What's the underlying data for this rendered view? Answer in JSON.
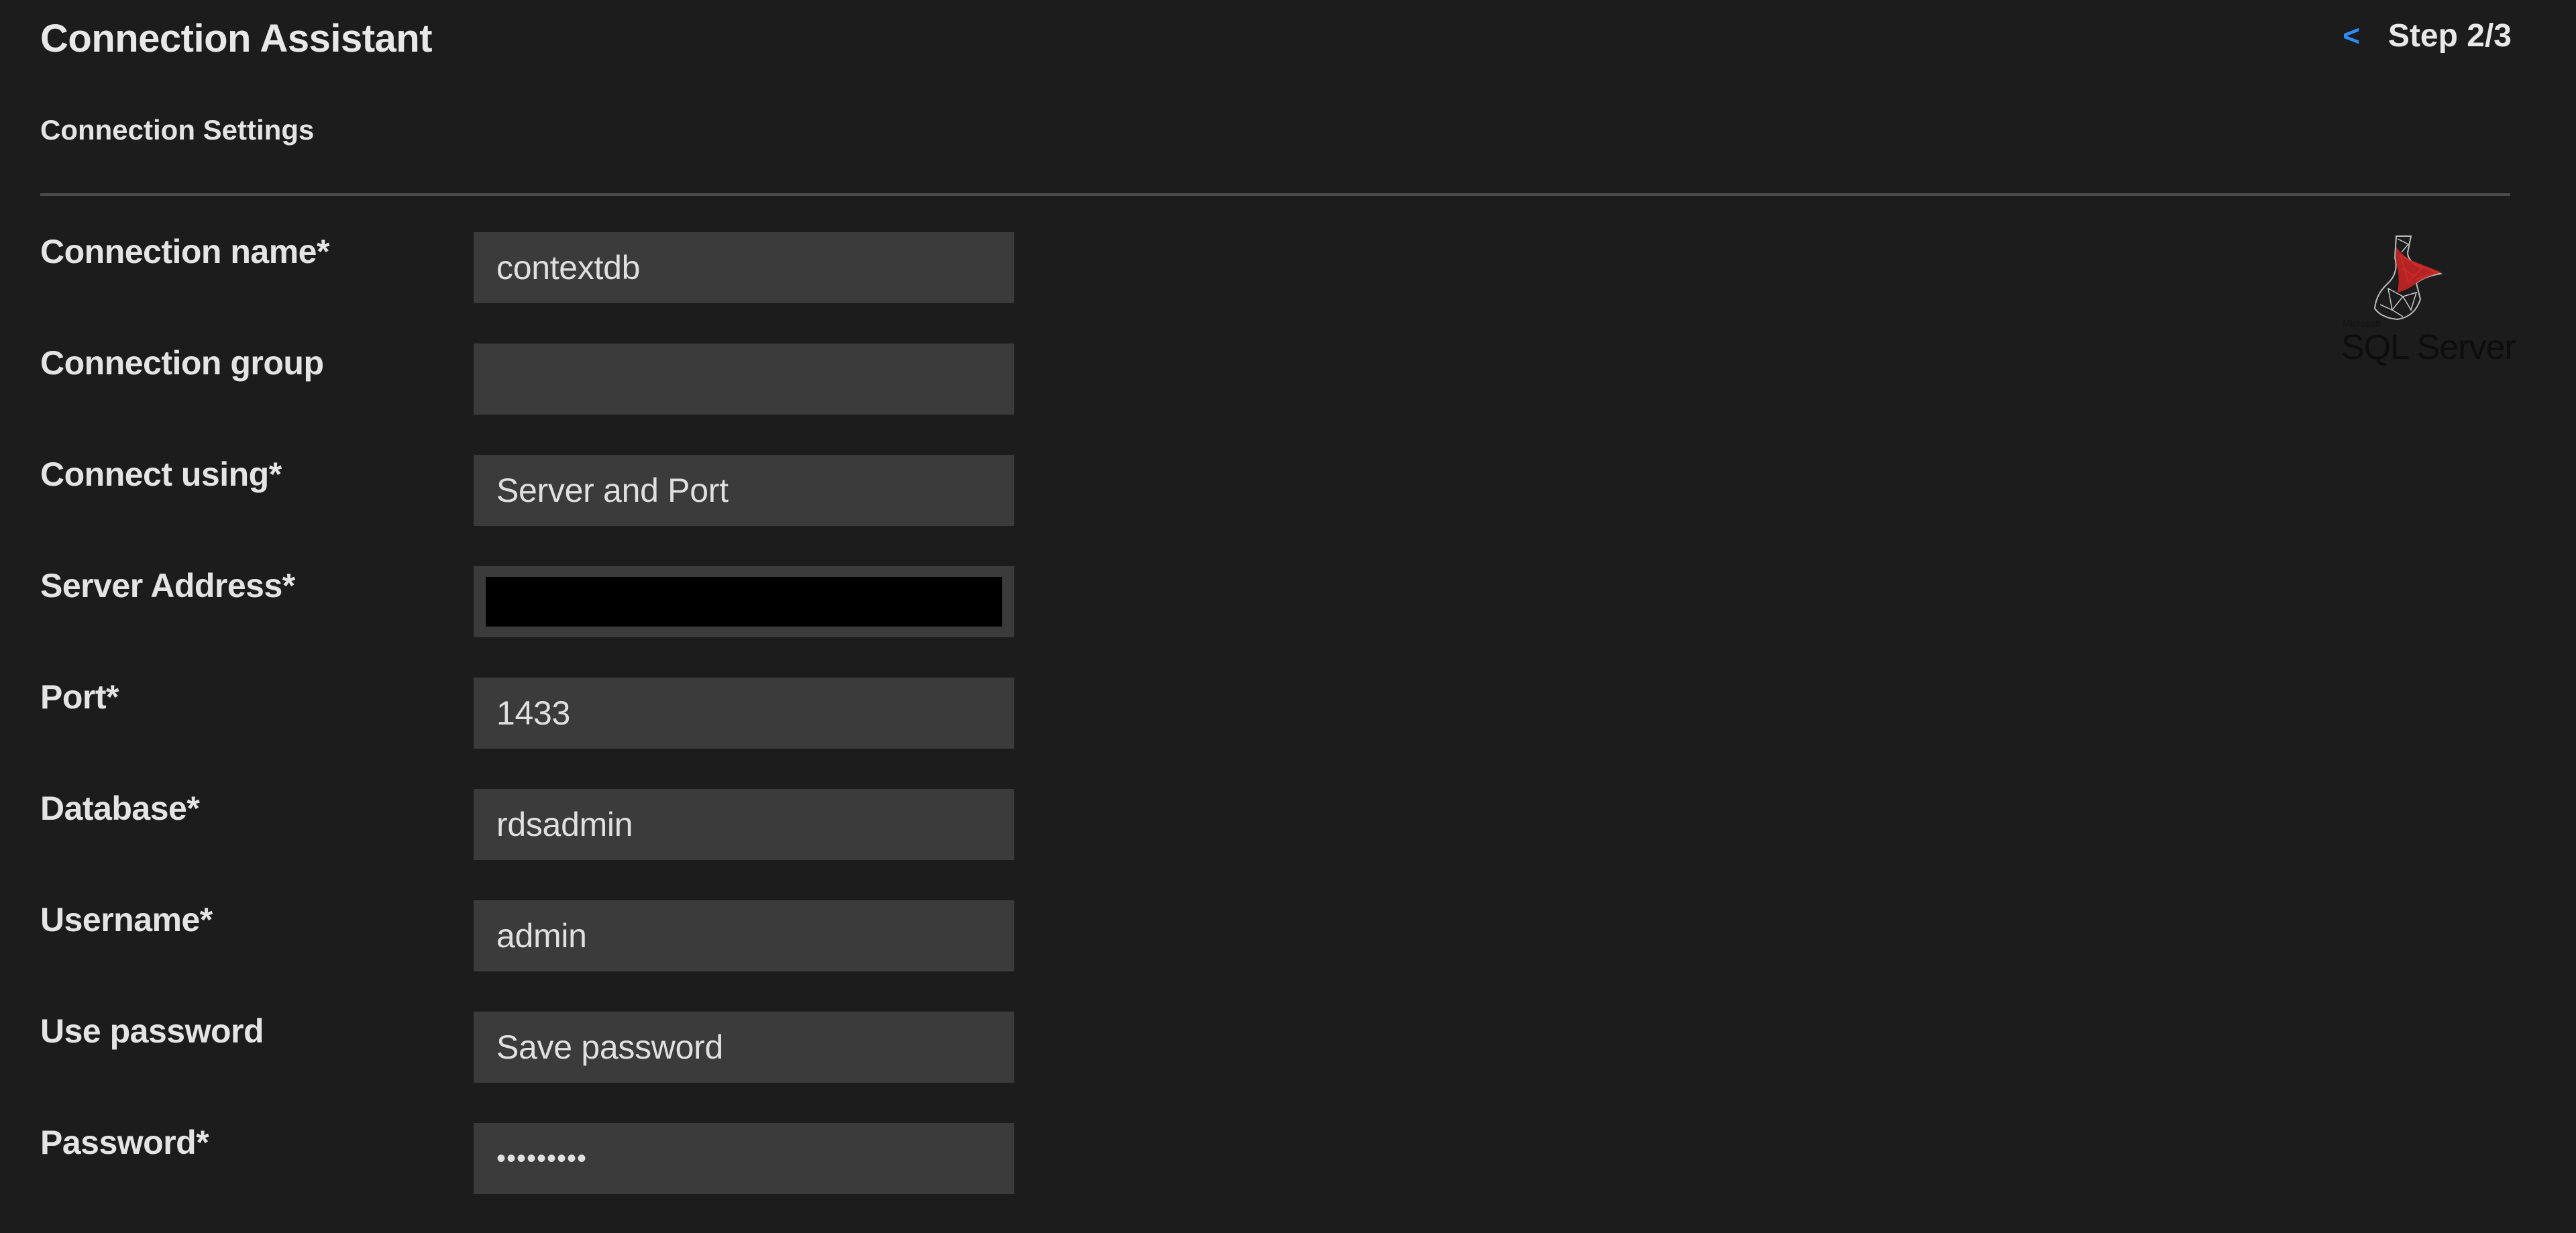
{
  "header": {
    "title": "Connection Assistant",
    "back_icon": "chevron-left-icon",
    "back_glyph": "<",
    "step_label": "Step 2/3",
    "step_current": 2,
    "step_total": 3
  },
  "section": {
    "title": "Connection Settings"
  },
  "form": {
    "fields": [
      {
        "label": "Connection name*",
        "value": "contextdb",
        "type": "text"
      },
      {
        "label": "Connection group",
        "value": "",
        "type": "select"
      },
      {
        "label": "Connect using*",
        "value": "Server and Port",
        "type": "select"
      },
      {
        "label": "Server Address*",
        "value": "",
        "type": "redacted"
      },
      {
        "label": "Port*",
        "value": "1433",
        "type": "text"
      },
      {
        "label": "Database*",
        "value": "rdsadmin",
        "type": "text"
      },
      {
        "label": "Username*",
        "value": "admin",
        "type": "text"
      },
      {
        "label": "Use password",
        "value": "Save password",
        "type": "select"
      },
      {
        "label": "Password*",
        "value": "•••••••••",
        "type": "password"
      }
    ]
  },
  "logo": {
    "icon": "sql-server-logo-icon",
    "brand_small": "Microsoft",
    "brand_text": "SQL Server",
    "colors": {
      "red": "#d62b2b",
      "grey": "#bdbdbd"
    }
  },
  "colors": {
    "background": "#1c1c1c",
    "field_background": "#3b3b3b",
    "accent": "#2f8cff",
    "text": "#e6e6e6",
    "separator": "#4a4a4a"
  }
}
